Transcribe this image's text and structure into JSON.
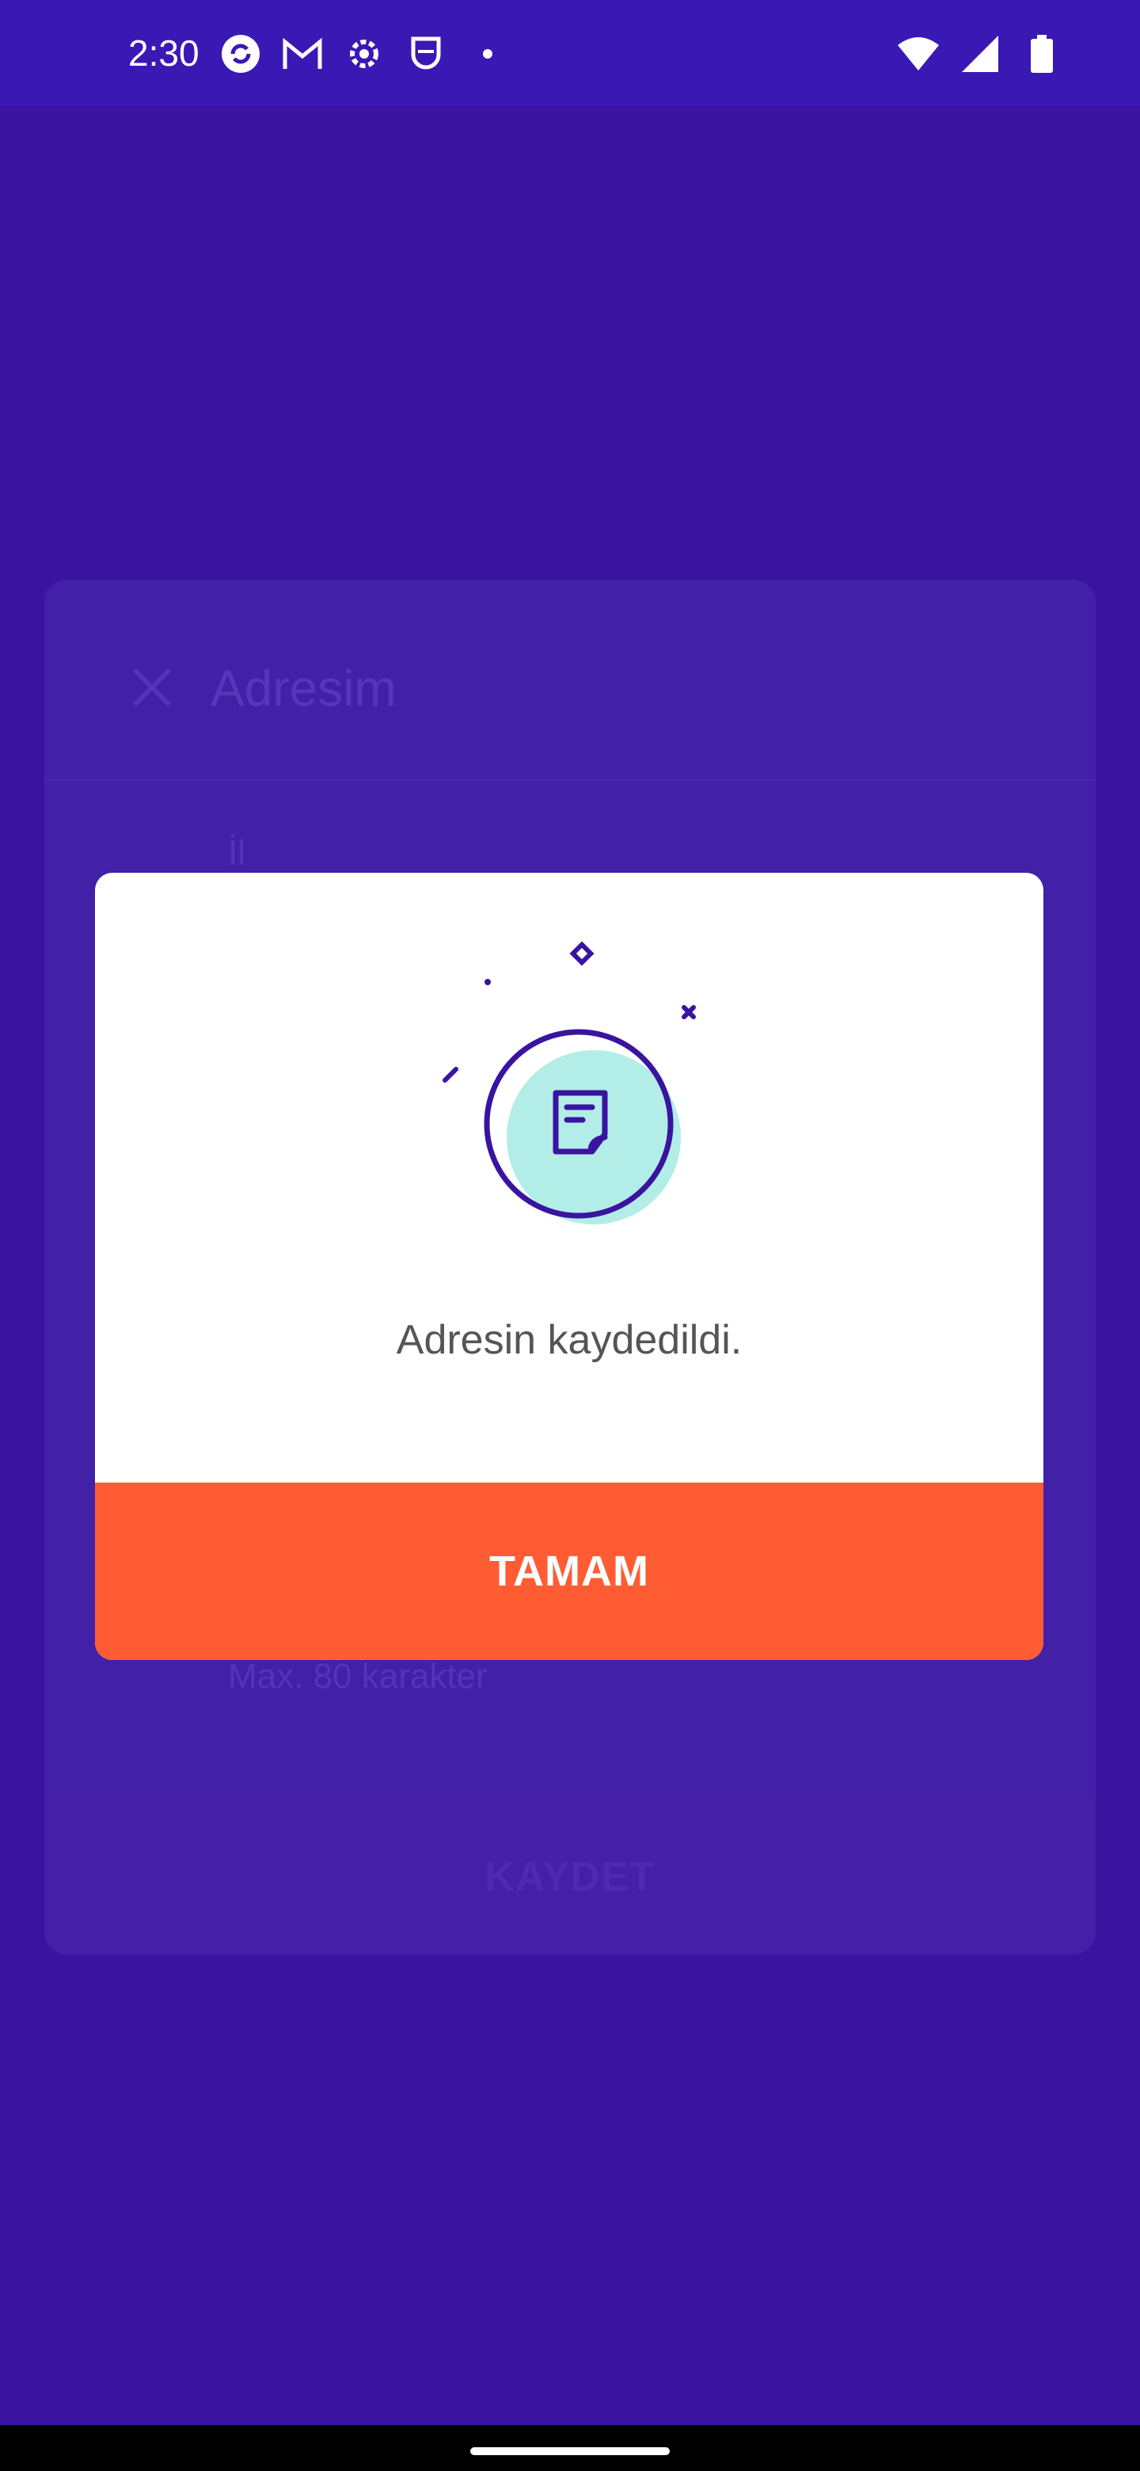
{
  "status_bar": {
    "time": "2:30",
    "left_icons": [
      "sync-icon",
      "gmail-icon",
      "settings-icon",
      "shield-icon",
      "dot-icon"
    ],
    "right_icons": [
      "wifi-icon",
      "signal-icon",
      "battery-icon"
    ]
  },
  "background_sheet": {
    "title": "Adresim",
    "field_label": "İl",
    "helper_text": "Max. 80 karakter",
    "save_label": "KAYDET"
  },
  "dialog": {
    "message": "Adresin kaydedildi.",
    "button_label": "TAMAM",
    "illustration_icon": "document-icon"
  },
  "colors": {
    "primary": "#3a14a0",
    "accent": "#ff5c33",
    "illustration_fill": "#b3ede8",
    "illustration_stroke": "#3a14a0"
  }
}
